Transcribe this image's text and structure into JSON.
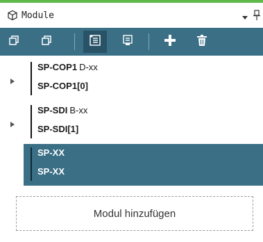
{
  "panel": {
    "title": "Module",
    "accent_color": "#5fb84a",
    "icons": {
      "header": "cube-icon",
      "menu": "caret-down-icon",
      "pin": "pin-icon"
    }
  },
  "toolbar": {
    "background": "#3a6f86",
    "buttons": [
      {
        "icon": "copy-stack-icon",
        "active": false
      },
      {
        "icon": "copy-stack-icon",
        "active": false
      },
      {
        "icon": "list-checked-icon",
        "active": true
      },
      {
        "icon": "list-doc-icon",
        "active": false
      },
      {
        "icon": "plus-icon",
        "active": false
      },
      {
        "icon": "trash-icon",
        "active": false
      }
    ]
  },
  "tree": {
    "items": [
      {
        "name": "SP-COP1",
        "variant": "D-xx",
        "instance": "SP-COP1[0]",
        "expandable": true,
        "selected": false
      },
      {
        "name": "SP-SDI",
        "variant": "B-xx",
        "instance": "SP-SDI[1]",
        "expandable": true,
        "selected": false
      },
      {
        "name": "SP-XX",
        "variant": "",
        "instance": "SP-XX",
        "expandable": false,
        "selected": true
      }
    ]
  },
  "add_module": {
    "label": "Modul hinzufügen"
  }
}
